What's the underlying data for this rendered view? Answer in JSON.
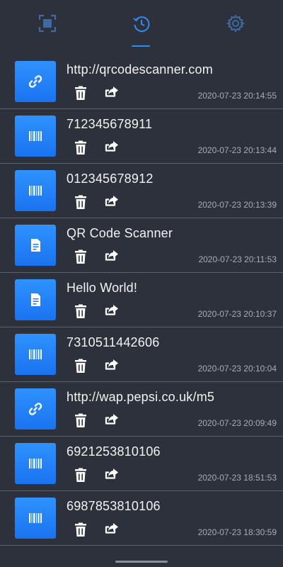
{
  "tabs": [
    {
      "name": "scan",
      "icon": "scan-icon",
      "active": false
    },
    {
      "name": "history",
      "icon": "history-icon",
      "active": true
    },
    {
      "name": "settings",
      "icon": "gear-icon",
      "active": false
    }
  ],
  "colors": {
    "background": "#2d313c",
    "accent": "#2f8cf0",
    "tab_inactive": "#3d6aa0",
    "divider": "#5a5f6a",
    "timestamp": "#a7acb5"
  },
  "history": [
    {
      "type": "link-icon",
      "text": "http://qrcodescanner.com",
      "time": "2020-07-23 20:14:55"
    },
    {
      "type": "barcode-icon",
      "text": "712345678911",
      "time": "2020-07-23 20:13:44"
    },
    {
      "type": "barcode-icon",
      "text": "012345678912",
      "time": "2020-07-23 20:13:39"
    },
    {
      "type": "text-icon",
      "text": "QR Code Scanner",
      "time": "2020-07-23 20:11:53"
    },
    {
      "type": "text-icon",
      "text": "Hello World!",
      "time": "2020-07-23 20:10:37"
    },
    {
      "type": "barcode-icon",
      "text": "7310511442606",
      "time": "2020-07-23 20:10:04"
    },
    {
      "type": "link-icon",
      "text": "http://wap.pepsi.co.uk/m5",
      "time": "2020-07-23 20:09:49"
    },
    {
      "type": "barcode-icon",
      "text": "6921253810106",
      "time": "2020-07-23 18:51:53"
    },
    {
      "type": "barcode-icon",
      "text": "6987853810106",
      "time": "2020-07-23 18:30:59"
    }
  ]
}
